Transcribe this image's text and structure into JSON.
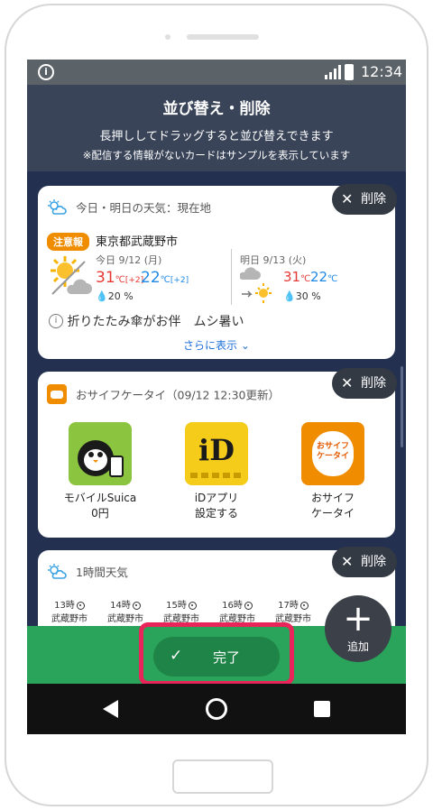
{
  "status_bar": {
    "time": "12:34",
    "info_glyph": "i"
  },
  "header": {
    "title": "並び替え・削除",
    "subtitle": "長押ししてドラッグすると並び替えできます",
    "note": "※配信する情報がないカードはサンプルを表示しています"
  },
  "delete_label": "削除",
  "weather_card": {
    "title": "今日・明日の天気：現在地",
    "badge": "注意報",
    "location": "東京都武蔵野市",
    "today": {
      "label": "今日 9/12 (月)",
      "high": "31",
      "high_diff": "[+2]",
      "low": "22",
      "low_diff": "[+2]",
      "rain": "20",
      "icon": "sun-cloud-icon"
    },
    "tomorrow": {
      "label": "明日 9/13 (火)",
      "high": "31",
      "low": "22",
      "rain": "30",
      "icon": "cloud-to-sun-icon"
    },
    "unit_temp": "℃",
    "unit_pct": "%",
    "note": "折りたたみ傘がお伴　ムシ暑い",
    "more": "さらに表示"
  },
  "osaifu_card": {
    "title": "おサイフケータイ（09/12 12:30更新）",
    "apps": [
      {
        "name": "モバイルSuica",
        "sub": "0円",
        "icon": "suica-icon"
      },
      {
        "name": "iDアプリ",
        "sub": "設定する",
        "icon": "id-app-icon"
      },
      {
        "name": "おサイフ",
        "sub": "ケータイ",
        "icon": "osaifu-keitai-icon"
      }
    ],
    "id_logo": "iD",
    "osaifu_logo": "おサイフ\nケータイ"
  },
  "hourly_card": {
    "title": "1時間天気",
    "hours": [
      {
        "time": "13時",
        "place": "武蔵野市"
      },
      {
        "time": "14時",
        "place": "武蔵野市"
      },
      {
        "time": "15時",
        "place": "武蔵野市"
      },
      {
        "time": "16時",
        "place": "武蔵野市"
      },
      {
        "time": "17時",
        "place": "武蔵野市"
      }
    ]
  },
  "fab": {
    "symbol": "+",
    "label": "追加"
  },
  "done_button": {
    "check": "✓",
    "label": "完了"
  },
  "colors": {
    "accent_green": "#2aa45a",
    "highlight": "#e8245a",
    "header": "#3a4458",
    "background": "#23304f"
  }
}
